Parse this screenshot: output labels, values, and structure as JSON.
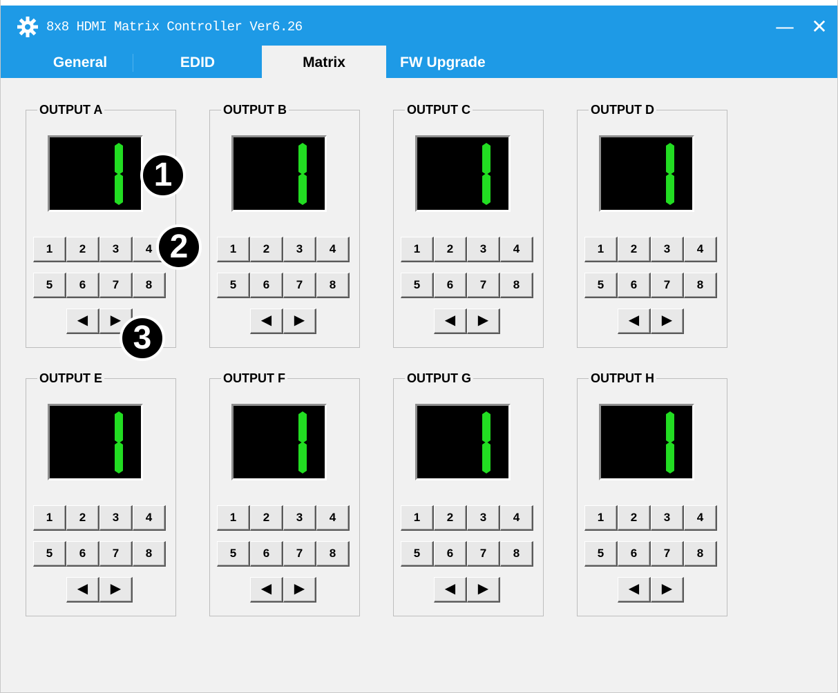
{
  "window": {
    "title": "8x8 HDMI Matrix Controller Ver6.26",
    "minimize_glyph": "—",
    "close_glyph": "✕",
    "icon": "gear-icon"
  },
  "tabs": [
    {
      "label": "General",
      "active": false
    },
    {
      "label": "EDID",
      "active": false
    },
    {
      "label": "Matrix",
      "active": true
    },
    {
      "label": "FW Upgrade",
      "active": false
    }
  ],
  "outputs": [
    {
      "label": "OUTPUT A",
      "current_input": "1"
    },
    {
      "label": "OUTPUT B",
      "current_input": "1"
    },
    {
      "label": "OUTPUT C",
      "current_input": "1"
    },
    {
      "label": "OUTPUT D",
      "current_input": "1"
    },
    {
      "label": "OUTPUT E",
      "current_input": "1"
    },
    {
      "label": "OUTPUT F",
      "current_input": "1"
    },
    {
      "label": "OUTPUT G",
      "current_input": "1"
    },
    {
      "label": "OUTPUT H",
      "current_input": "1"
    }
  ],
  "input_buttons": [
    "1",
    "2",
    "3",
    "4",
    "5",
    "6",
    "7",
    "8"
  ],
  "nav_buttons": {
    "prev": "◀",
    "next": "▶"
  },
  "callouts": [
    "1",
    "2",
    "3"
  ],
  "colors": {
    "titlebar": "#1e9ae6",
    "display_bg": "#000000",
    "digit": "#22dd22"
  }
}
